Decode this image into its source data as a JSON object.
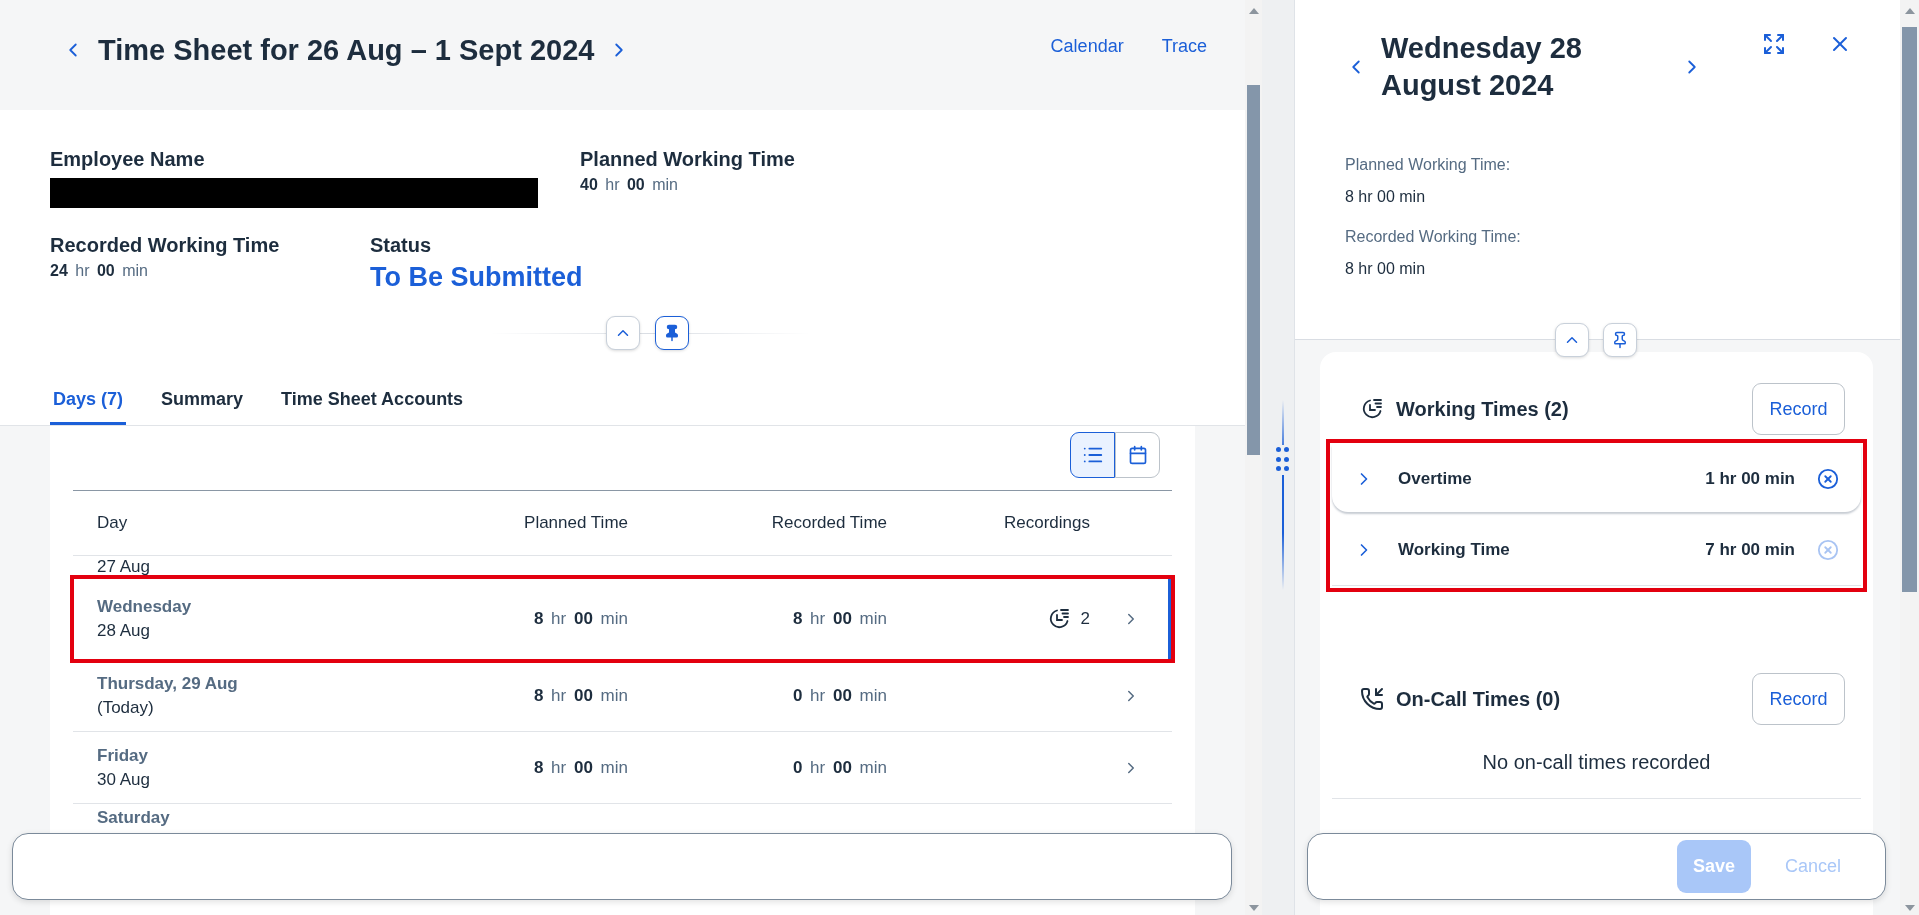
{
  "timesheet": {
    "title": "Time Sheet for 26 Aug – 1 Sept 2024",
    "links": [
      "Calendar",
      "Trace"
    ]
  },
  "employee": {
    "label": "Employee Name",
    "redacted": true
  },
  "planned": {
    "label": "Planned Working Time",
    "value": "**40** hr **00** min"
  },
  "recorded": {
    "label": "Recorded Working Time",
    "value": "**24** hr **00** min"
  },
  "status": {
    "label": "Status",
    "value": "To Be Submitted"
  },
  "tabs": [
    {
      "label": "Days (7)",
      "selected": true
    },
    {
      "label": "Summary",
      "selected": false
    },
    {
      "label": "Time Sheet Accounts",
      "selected": false
    }
  ],
  "view_toggle": [
    {
      "kind": "list",
      "selected": true
    },
    {
      "kind": "calendar",
      "selected": false
    }
  ],
  "table": {
    "columns": [
      "Day",
      "Planned Time",
      "Recorded Time",
      "Recordings"
    ],
    "rows": [
      {
        "date": "27 Aug",
        "selected": false,
        "annotated": false
      },
      {
        "day": "Wednesday",
        "date": "28 Aug",
        "planned": "**8** hr **00** min",
        "recorded": "**8** hr **00** min",
        "recordings": "2",
        "selected": true,
        "annotated": true
      },
      {
        "day": "Thursday, 29 Aug",
        "date": "(Today)",
        "planned": "**8** hr **00** min",
        "recorded": "**0** hr **00** min",
        "selected": false,
        "annotated": false
      },
      {
        "day": "Friday",
        "date": "30 Aug",
        "planned": "**8** hr **00** min",
        "recorded": "**0** hr **00** min",
        "selected": false,
        "annotated": false
      },
      {
        "day": "Saturday",
        "selected": false,
        "annotated": false
      }
    ]
  },
  "detail": {
    "title": "Wednesday 28 August 2024",
    "fields": [
      {
        "label": "Planned Working Time:",
        "value": "8 hr 00 min"
      },
      {
        "label": "Recorded Working Time:",
        "value": "8 hr 00 min"
      }
    ],
    "sections": [
      {
        "kind": "working",
        "title": "Working Times (2)",
        "action": "Record",
        "annotated": true,
        "items": [
          {
            "name": "Overtime",
            "duration": "1 hr 00 min",
            "removable": true
          },
          {
            "name": "Working Time",
            "duration": "7 hr 00 min",
            "removable": false
          }
        ]
      },
      {
        "kind": "oncall",
        "title": "On-Call Times (0)",
        "action": "Record",
        "empty_text": "No on-call times recorded"
      }
    ],
    "footer": [
      {
        "label": "Save",
        "kind": "primary",
        "disabled": true
      },
      {
        "label": "Cancel",
        "kind": "plain",
        "disabled": true
      }
    ]
  }
}
